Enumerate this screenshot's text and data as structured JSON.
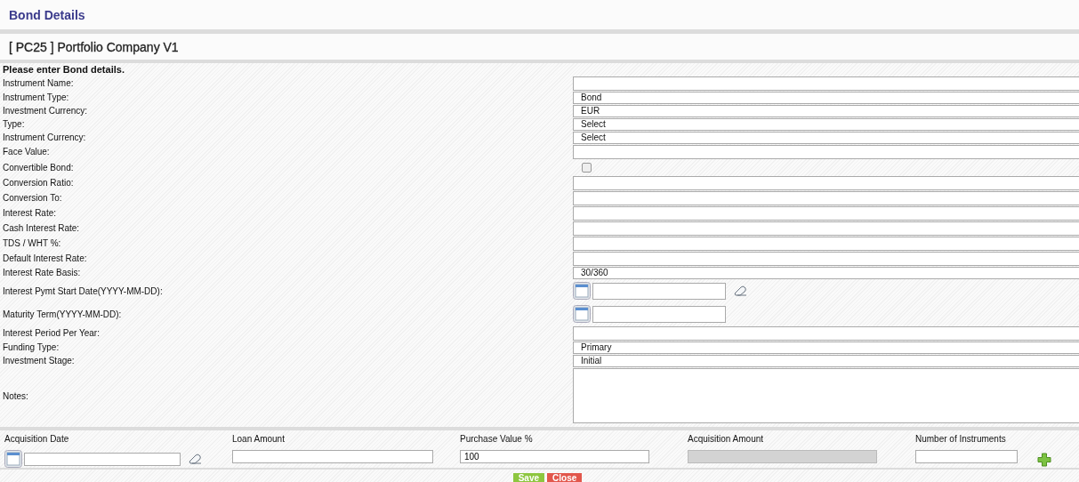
{
  "header": {
    "title": "Bond Details"
  },
  "company": {
    "title": "[ PC25 ] Portfolio Company V1"
  },
  "form": {
    "intro": "Please enter Bond details.",
    "fields": [
      {
        "label": "Instrument Name:",
        "kind": "text"
      },
      {
        "label": "Instrument Type:",
        "kind": "select",
        "value": "Bond"
      },
      {
        "label": "Investment Currency:",
        "kind": "select",
        "value": "EUR"
      },
      {
        "label": "Type:",
        "kind": "select",
        "value": "Select"
      },
      {
        "label": "Instrument Currency:",
        "kind": "select",
        "value": "Select"
      },
      {
        "label": "Face Value:",
        "kind": "text"
      },
      {
        "label": "Convertible Bond:",
        "kind": "checkbox",
        "checked": false
      },
      {
        "label": "Conversion Ratio:",
        "kind": "text"
      },
      {
        "label": "Conversion To:",
        "kind": "text"
      },
      {
        "label": "Interest Rate:",
        "kind": "text"
      },
      {
        "label": "Cash Interest Rate:",
        "kind": "text"
      },
      {
        "label": "TDS / WHT %:",
        "kind": "text"
      },
      {
        "label": "Default Interest Rate:",
        "kind": "text"
      },
      {
        "label": "Interest Rate Basis:",
        "kind": "select",
        "value": "30/360"
      },
      {
        "label": "Interest Pymt Start Date(YYYY-MM-DD):",
        "kind": "date",
        "clearable": true
      },
      {
        "label": "Maturity Term(YYYY-MM-DD):",
        "kind": "date",
        "clearable": false
      },
      {
        "label": "Interest Period Per Year:",
        "kind": "text"
      },
      {
        "label": "Funding Type:",
        "kind": "select",
        "value": "Primary"
      },
      {
        "label": "Investment Stage:",
        "kind": "select",
        "value": "Initial"
      },
      {
        "label": "Notes:",
        "kind": "textarea"
      }
    ]
  },
  "acquisition": {
    "columns": [
      {
        "label": "Acquisition Date",
        "kind": "date",
        "clearable": true
      },
      {
        "label": "Loan Amount",
        "kind": "text"
      },
      {
        "label": "Purchase Value %",
        "kind": "text",
        "value": "100"
      },
      {
        "label": "Acquisition Amount",
        "kind": "text",
        "disabled": true
      },
      {
        "label": "Number of Instruments",
        "kind": "text"
      }
    ]
  },
  "buttons": [
    {
      "label": "Save",
      "kind": "save"
    },
    {
      "label": "Close",
      "kind": "close"
    }
  ]
}
